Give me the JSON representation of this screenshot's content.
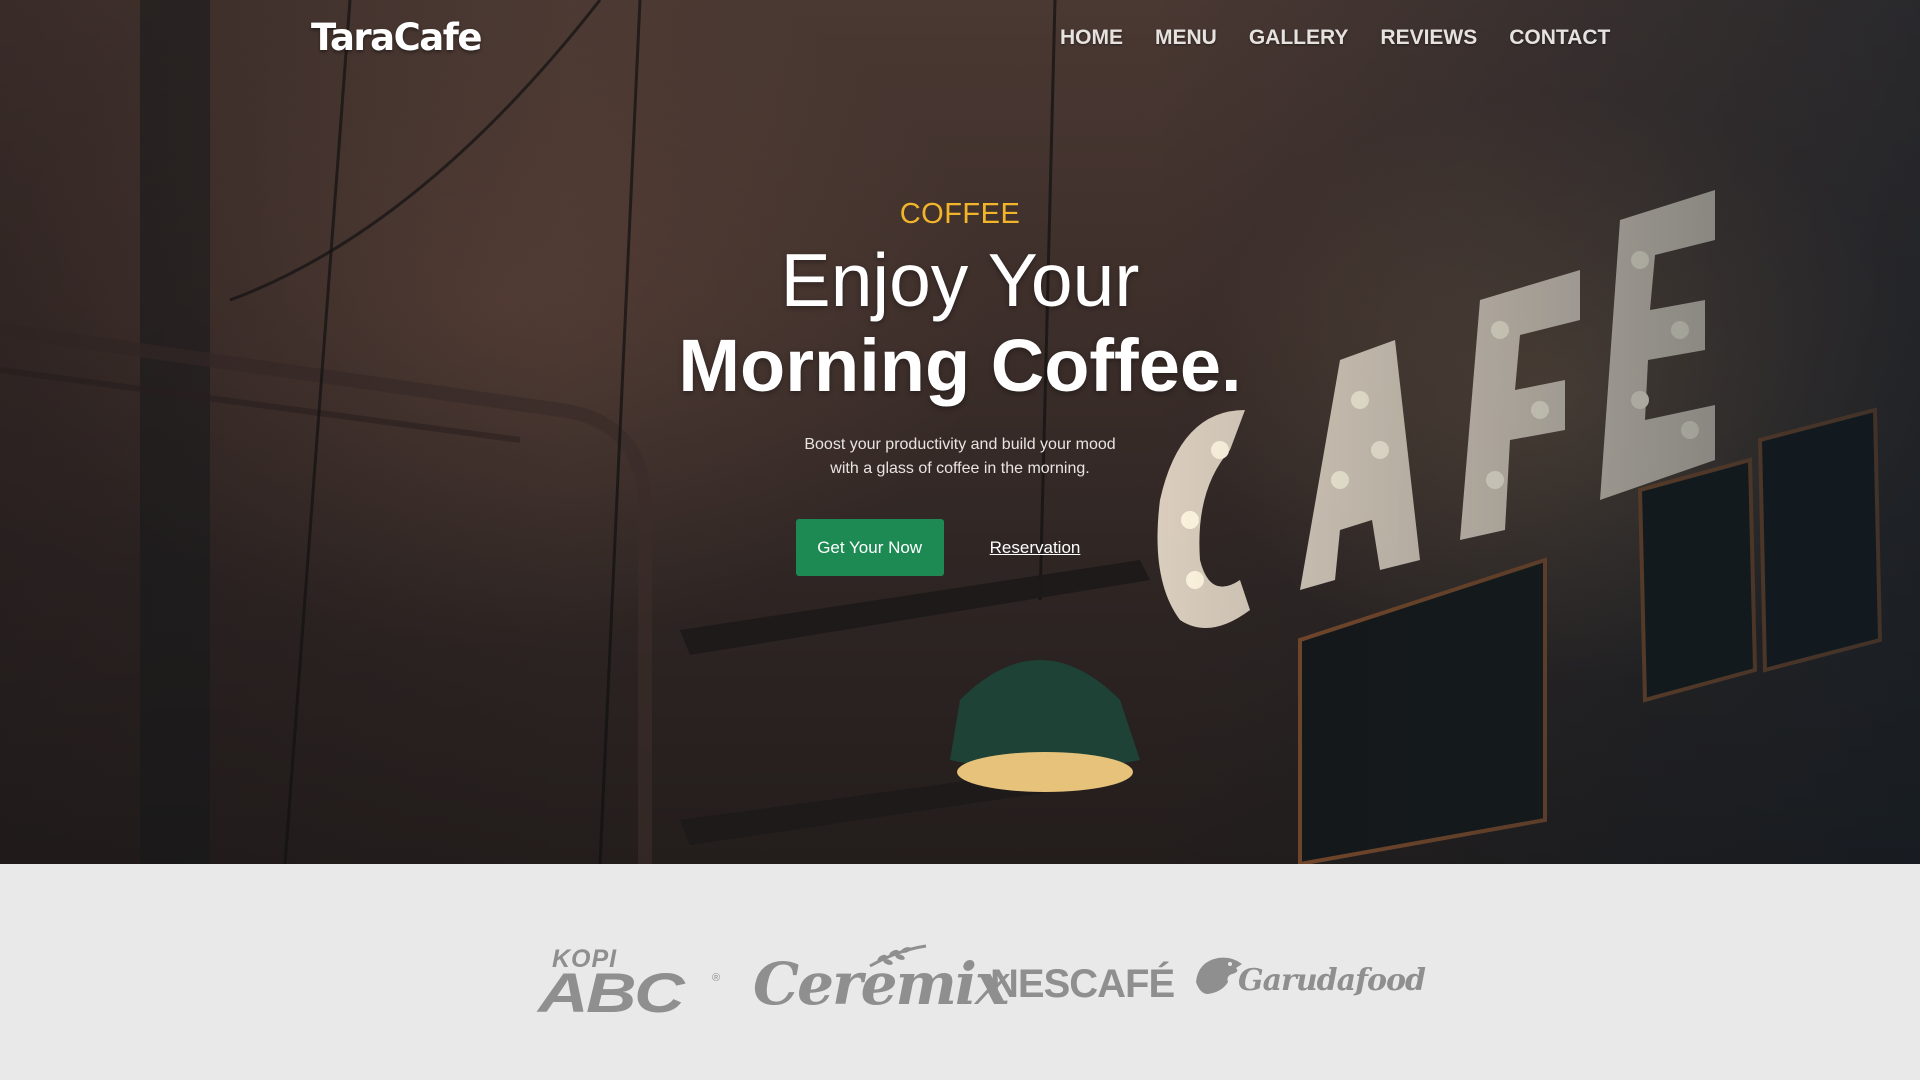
{
  "brand": {
    "name": "TaraCafe"
  },
  "nav": {
    "items": [
      {
        "label": "HOME"
      },
      {
        "label": "MENU"
      },
      {
        "label": "GALLERY"
      },
      {
        "label": "REVIEWS"
      },
      {
        "label": "CONTACT"
      }
    ]
  },
  "hero": {
    "eyebrow": "COFFEE",
    "headline_line1": "Enjoy Your",
    "headline_line2": "Morning Coffee.",
    "subtext": "Boost your productivity and build your mood with a glass of coffee in the morning.",
    "primary_button": "Get Your Now",
    "secondary_link": "Reservation",
    "colors": {
      "accent": "#f2b52a",
      "button": "#1e8a53"
    },
    "background_sign_text": "CAFE"
  },
  "partners": {
    "logos": [
      {
        "name": "KOPI ABC",
        "line1": "KOPI",
        "line2": "ABC",
        "mark": "®"
      },
      {
        "name": "Ceremix",
        "text": "Ceremix"
      },
      {
        "name": "NESCAFÉ",
        "text": "NESCAFÉ"
      },
      {
        "name": "Garudafood",
        "text": "Garudafood",
        "icon": "garuda-bird-icon"
      }
    ]
  }
}
